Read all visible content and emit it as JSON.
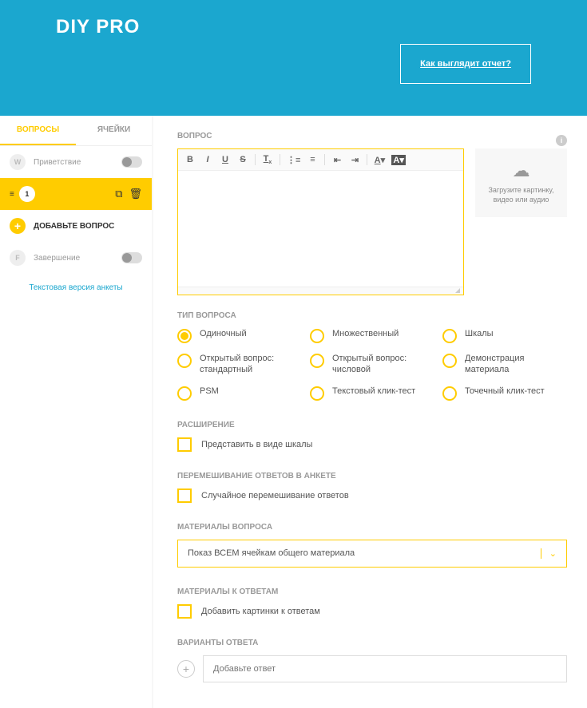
{
  "header": {
    "logo": "DIY PRO",
    "report_btn": "Как выглядит отчет?"
  },
  "tabs": {
    "questions": "ВОПРОСЫ",
    "cells": "ЯЧЕЙКИ"
  },
  "sidebar": {
    "greeting": {
      "badge": "W",
      "label": "Приветствие"
    },
    "active": {
      "badge": "1"
    },
    "add": "ДОБАВЬТЕ ВОПРОС",
    "completion": {
      "badge": "F",
      "label": "Завершение"
    },
    "text_version": "Текстовая версия анкеты"
  },
  "main": {
    "question_label": "ВОПРОС",
    "upload": "Загрузите картинку, видео или аудио",
    "qtype_label": "ТИП ВОПРОСА",
    "qtypes": [
      "Одиночный",
      "Множественный",
      "Шкалы",
      "Открытый вопрос: стандартный",
      "Открытый вопрос: числовой",
      "Демонстрация материала",
      "PSM",
      "Текстовый клик-тест",
      "Точечный клик-тест"
    ],
    "extension_label": "РАСШИРЕНИЕ",
    "extension_cb": "Представить в виде шкалы",
    "shuffle_label": "ПЕРЕМЕШИВАНИЕ ОТВЕТОВ В АНКЕТЕ",
    "shuffle_cb": "Случайное перемешивание ответов",
    "materials_label": "МАТЕРИАЛЫ ВОПРОСА",
    "materials_value": "Показ ВСЕМ ячейкам общего материала",
    "answer_materials_label": "МАТЕРИАЛЫ К ОТВЕТАМ",
    "answer_materials_cb": "Добавить картинки к ответам",
    "answers_label": "ВАРИАНТЫ ОТВЕТА",
    "answer_placeholder": "Добавьте ответ"
  },
  "toolbar": {
    "bold": "B",
    "italic": "I",
    "underline": "U",
    "strike": "S"
  }
}
